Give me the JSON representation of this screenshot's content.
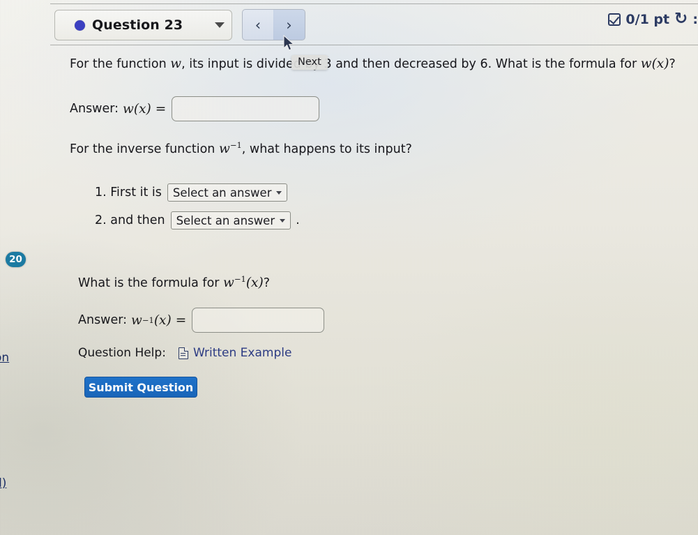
{
  "header": {
    "question_label": "Question 23",
    "dropdown_caret": "caret-down-icon",
    "status_dot": "blue-dot-icon",
    "prev_label": "‹",
    "next_label": "›",
    "score_text": "0/1 pt",
    "score_tail": ":",
    "check_icon": "checkbox-checked-icon",
    "retry_icon": "↺"
  },
  "body": {
    "prompt_1_a": "For the function ",
    "prompt_1_w": "w",
    "prompt_1_b": ", its input is divided by 3 and then decreased by 6. What is the formula for ",
    "prompt_1_wx": "w(x)",
    "prompt_1_c": "?",
    "answer_1_label": "Answer:",
    "answer_1_fn": "w(x)",
    "answer_1_eq": "=",
    "answer_1_value": "",
    "prompt_2_a": "For the inverse function ",
    "prompt_2_w": "w",
    "prompt_2_exp": "−1",
    "prompt_2_b": ", what happens to its input?",
    "steps": [
      {
        "number": "1. First it is",
        "select_value": "Select an answer",
        "trailing": ""
      },
      {
        "number": "2. and then",
        "select_value": "Select an answer",
        "trailing": "."
      }
    ],
    "badge_20": "20",
    "prompt_3_a": "What is the formula for ",
    "prompt_3_w": "w",
    "prompt_3_exp": "−1",
    "prompt_3_b": "(x)",
    "prompt_3_c": "?",
    "answer_2_label": "Answer:",
    "answer_2_fn_w": "w",
    "answer_2_fn_exp": "−1",
    "answer_2_fn_x": "(x)",
    "answer_2_eq": "=",
    "answer_2_value": "",
    "help_label": "Question Help:",
    "help_link": "Written Example",
    "help_icon": "document-icon",
    "submit_label": "Submit Question"
  },
  "overlay": {
    "tooltip_label": "Next",
    "cursor": "mouse-pointer-icon"
  },
  "background_links": {
    "link_1": "on",
    "link_2": "d)"
  },
  "colors": {
    "accent_blue": "#1d72cc",
    "badge_teal": "#1a7ba4",
    "link_navy": "#2b3a84",
    "status_dot": "#3b3fc4",
    "page_bg": "#eeece4"
  }
}
